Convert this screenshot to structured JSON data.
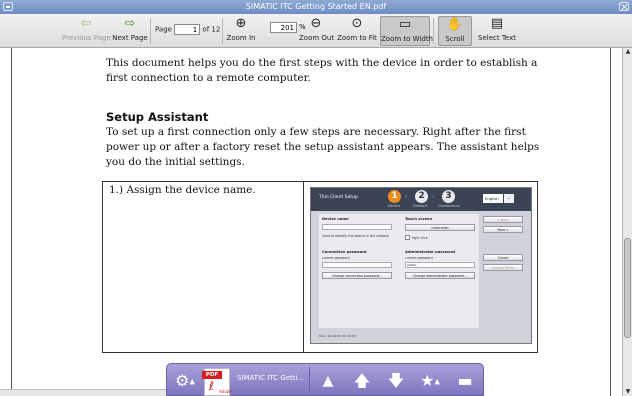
{
  "window": {
    "title": "SIMATIC ITC Getting Started EN.pdf"
  },
  "toolbar": {
    "prev_page": "Previous Page",
    "next_page": "Next Page",
    "page_label": "Page",
    "page_value": "1",
    "page_of": "of 12",
    "zoom_in": "Zoom In",
    "zoom_value": "201",
    "zoom_unit": "%",
    "zoom_out": "Zoom Out",
    "zoom_to_fit": "Zoom to Fit",
    "zoom_to_width": "Zoom to Width",
    "scroll": "Scroll",
    "select_text": "Select Text"
  },
  "document": {
    "intro": "This document helps you do the first steps with the device in order to establish a first connection to a remote computer.",
    "heading": "Setup Assistant",
    "para": "To set up a first connection only a few steps are necessary. Right after the first power up or after a factory reset the setup assistant appears. The assistant helps you do the initial settings.",
    "step1": "1.) Assign the device name."
  },
  "screenshot": {
    "title": "Thin Client Setup",
    "steps": [
      {
        "num": "1",
        "label": "Device"
      },
      {
        "num": "2",
        "label": "Network"
      },
      {
        "num": "3",
        "label": "Connections"
      }
    ],
    "language": "English",
    "device_name": "Device name",
    "device_hint": "Used to identify the device in the network",
    "touch_screen": "Touch screen",
    "calibration": "Calibration",
    "right_click": "right click",
    "conn_password": "Connection password",
    "admin_password": "Administrator password",
    "current_password": "current password",
    "admin_current_password": "current password",
    "admin_value": "admin",
    "change_conn_password": "Change connection password...",
    "change_admin_password": "Change administrator password...",
    "back": "< Back",
    "next": "Next >",
    "cancel": "Cancel",
    "finish": "Factory Reset",
    "bottom": "MAC: 00:00:00:00:00:00"
  },
  "dock": {
    "app_label": "SIMATIC ITC Getti...",
    "pdf_badge": "PDF",
    "adobe": "Adobe"
  },
  "colors": {
    "titlebar": "#7b97cc",
    "dock": "#8f88cc",
    "step_active": "#f08a1c",
    "pdf_red": "#d71f1f"
  }
}
